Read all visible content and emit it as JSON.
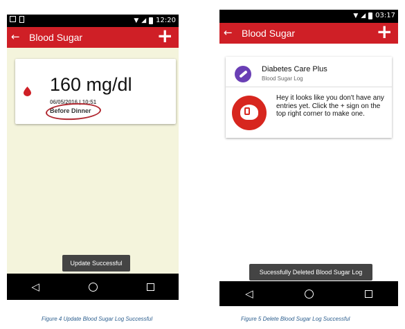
{
  "screen1": {
    "status_time": "12:20",
    "title": "Blood Sugar",
    "reading": "160 mg/dl",
    "datetime": "06/05/2016 | 10:51",
    "meal": "Before Dinner",
    "toast": "Update Successful"
  },
  "screen2": {
    "status_time": "03:17",
    "title": "Blood Sugar",
    "app_name": "Diabetes Care Plus",
    "app_subtitle": "Blood Sugar Log",
    "empty_message": "Hey it looks like you don't have any entries yet. Click the + sign on the top right corner to make one.",
    "toast": "Sucessfully Deleted Blood Sugar Log"
  },
  "captions": {
    "figure4": "Figure 4 Update Blood Sugar Log Successful",
    "figure5": "Figure 5 Delete Blood Sugar Log Successful"
  },
  "icons": {
    "back": "arrow-left-icon",
    "add": "plus-icon",
    "nav_back": "triangle-back-icon",
    "nav_home": "circle-home-icon",
    "nav_recent": "square-recent-icon"
  },
  "colors": {
    "toolbar": "#cf1f26",
    "screen1_bg": "#f4f4dc",
    "toast": "#444444",
    "annotation_circle": "#b0262e"
  }
}
